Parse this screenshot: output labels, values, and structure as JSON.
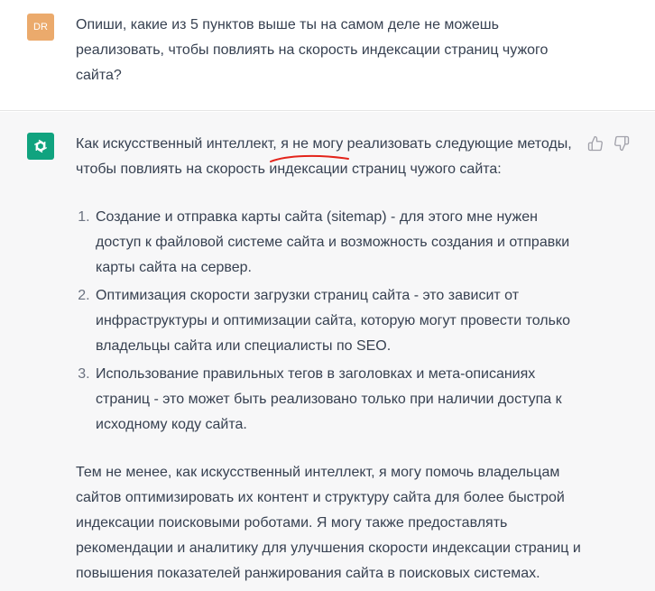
{
  "user_message": {
    "avatar_initials": "DR",
    "avatar_color": "#ebaa6c",
    "text": "Опиши, какие из 5 пунктов выше ты на самом деле не можешь реализовать, чтобы повлиять на скорость индексации страниц чужого сайта?"
  },
  "assistant_message": {
    "avatar_icon": "openai-logo-icon",
    "avatar_color": "#10a37f",
    "intro_part1": "Как искусственный интеллект",
    "intro_part2": ", я не могу",
    "intro_part3": " реализовать следующие методы, чтобы повлиять на скорость индексации страниц чужого сайта:",
    "underline_color": "#e3241b",
    "items": [
      "Создание и отправка карты сайта (sitemap) - для этого мне нужен доступ к файловой системе сайта и возможность создания и отправки карты сайта на сервер.",
      "Оптимизация скорости загрузки страниц сайта - это зависит от инфраструктуры и оптимизации сайта, которую могут провести только владельцы сайта или специалисты по SEO.",
      "Использование правильных тегов в заголовках и мета-описаниях страниц - это может быть реализовано только при наличии доступа к исходному коду сайта."
    ],
    "outro": "Тем не менее, как искусственный интеллект, я могу помочь владельцам сайтов оптимизировать их контент и структуру сайта для более быстрой индексации поисковыми роботами. Я могу также предоставлять рекомендации и аналитику для улучшения скорости индексации страниц и повышения показателей ранжирования сайта в поисковых системах."
  },
  "feedback": {
    "thumbs_up_icon": "thumbs-up-icon",
    "thumbs_down_icon": "thumbs-down-icon"
  }
}
